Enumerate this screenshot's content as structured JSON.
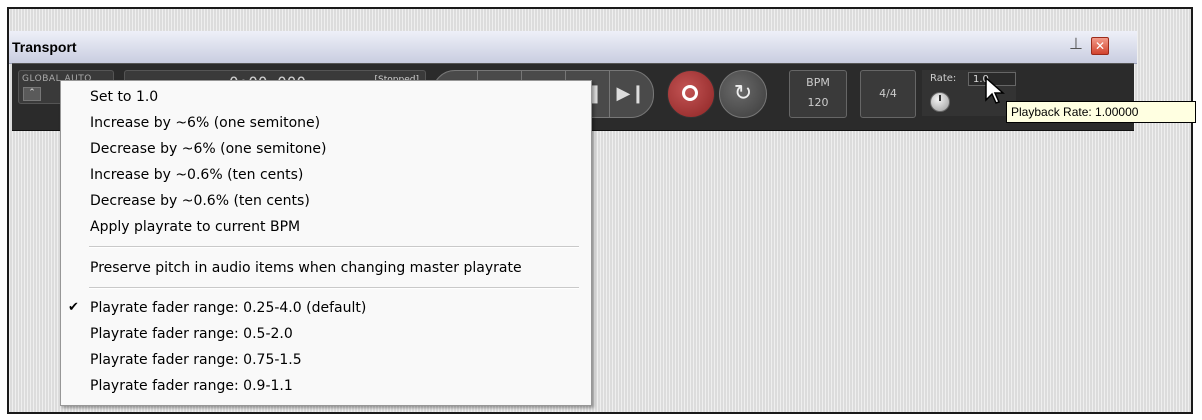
{
  "window": {
    "title": "Transport"
  },
  "titlebar": {
    "pin_icon": "pin-icon",
    "close_icon": "close-icon"
  },
  "transport": {
    "global_auto_label": "GLOBAL AUTO",
    "time": "0:00.000",
    "status": "[Stopped]",
    "bpm_label": "BPM",
    "bpm_value": "120",
    "time_signature": "4/4",
    "rate_label": "Rate:",
    "rate_value": "1.0"
  },
  "tooltip": {
    "text": "Playback Rate: 1.00000"
  },
  "menu": {
    "items": [
      {
        "label": "Set to 1.0"
      },
      {
        "label": "Increase by ~6% (one semitone)"
      },
      {
        "label": "Decrease by ~6% (one semitone)"
      },
      {
        "label": "Increase by ~0.6% (ten cents)"
      },
      {
        "label": "Decrease by ~0.6% (ten cents)"
      },
      {
        "label": "Apply playrate to current BPM"
      },
      {
        "label": "Preserve pitch in audio items when changing master playrate"
      },
      {
        "label": "Playrate fader range: 0.25-4.0 (default)",
        "checked": true
      },
      {
        "label": "Playrate fader range: 0.5-2.0"
      },
      {
        "label": "Playrate fader range: 0.75-1.5"
      },
      {
        "label": "Playrate fader range: 0.9-1.1"
      }
    ],
    "check_glyph": "✔"
  },
  "colors": {
    "record": "#a33636",
    "tooltip_bg": "#ffffe1",
    "titlebar": "#c9cde0"
  }
}
